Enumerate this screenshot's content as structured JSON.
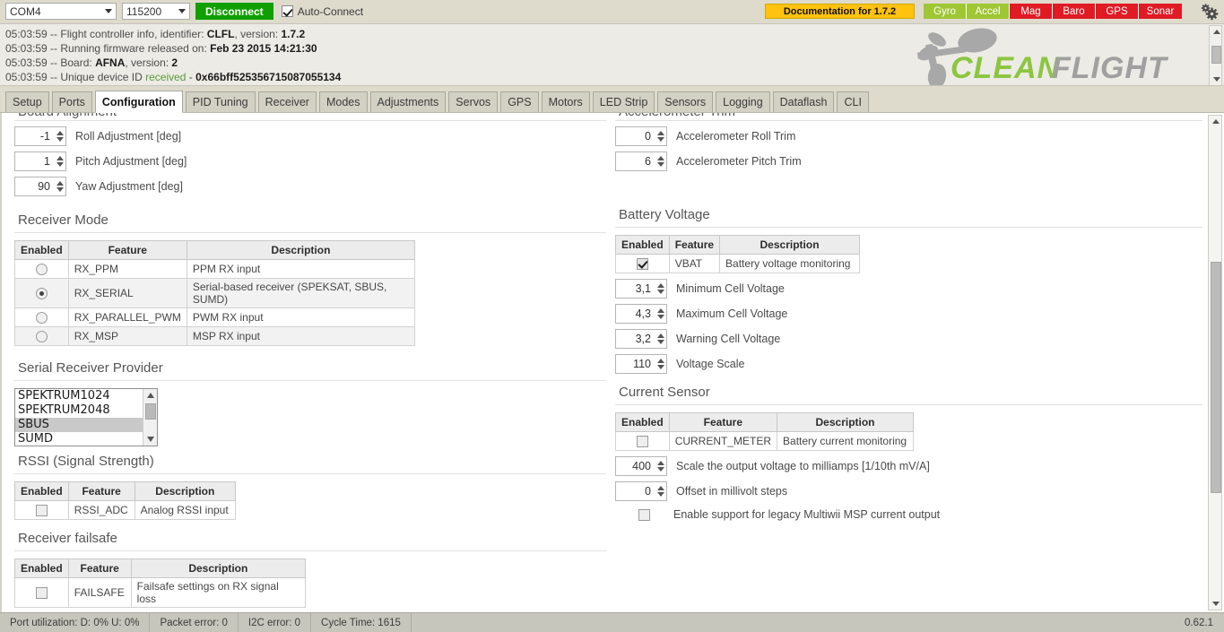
{
  "topbar": {
    "port": "COM4",
    "baud": "115200",
    "connect_label": "Disconnect",
    "autoconnect_label": "Auto-Connect",
    "autoconnect_checked": true,
    "documentation_label": "Documentation for 1.7.2",
    "doc_color": "#ffc20e",
    "sensors": [
      {
        "label": "Gyro",
        "color": "#9fc633",
        "active": true
      },
      {
        "label": "Accel",
        "color": "#9fc633",
        "active": true
      },
      {
        "label": "Mag",
        "color": "#e01b24",
        "active": false
      },
      {
        "label": "Baro",
        "color": "#e01b24",
        "active": false
      },
      {
        "label": "GPS",
        "color": "#e01b24",
        "active": false
      },
      {
        "label": "Sonar",
        "color": "#e01b24",
        "active": false
      }
    ],
    "gear_icon": "gear-icon"
  },
  "header_log": {
    "lines": [
      {
        "time": "05:03:59",
        "sep": " -- ",
        "text": "Flight controller info, identifier: ",
        "bold1": "CLFL",
        "mid": ", version: ",
        "bold2": "1.7.2"
      },
      {
        "time": "05:03:59",
        "sep": " -- ",
        "text": "Running firmware released on: ",
        "bold1": "Feb 23 2015 14:21:30",
        "mid": "",
        "bold2": ""
      },
      {
        "time": "05:03:59",
        "sep": " -- ",
        "text": "Board: ",
        "bold1": "AFNA",
        "mid": ", version: ",
        "bold2": "2"
      },
      {
        "time": "05:03:59",
        "sep": " -- ",
        "text": "Unique device ID received - ",
        "bold1": "0x66bff525356715087055134",
        "mid": "",
        "bold2": ""
      }
    ],
    "logo_text_1": "CLEAN",
    "logo_text_2": "FLIGHT",
    "logo_color_1": "#8cc63f",
    "logo_color_2": "#a0a0a0"
  },
  "tabs": [
    {
      "label": "Setup",
      "active": false
    },
    {
      "label": "Ports",
      "active": false
    },
    {
      "label": "Configuration",
      "active": true
    },
    {
      "label": "PID Tuning",
      "active": false
    },
    {
      "label": "Receiver",
      "active": false
    },
    {
      "label": "Modes",
      "active": false
    },
    {
      "label": "Adjustments",
      "active": false
    },
    {
      "label": "Servos",
      "active": false
    },
    {
      "label": "GPS",
      "active": false
    },
    {
      "label": "Motors",
      "active": false
    },
    {
      "label": "LED Strip",
      "active": false
    },
    {
      "label": "Sensors",
      "active": false
    },
    {
      "label": "Logging",
      "active": false
    },
    {
      "label": "Dataflash",
      "active": false
    },
    {
      "label": "CLI",
      "active": false
    }
  ],
  "board_alignment": {
    "title": "Board Alignment",
    "rows": [
      {
        "value": "-1",
        "label": "Roll Adjustment [deg]"
      },
      {
        "value": "1",
        "label": "Pitch Adjustment [deg]"
      },
      {
        "value": "90",
        "label": "Yaw Adjustment [deg]"
      }
    ]
  },
  "receiver_mode": {
    "title": "Receiver Mode",
    "headers": [
      "Enabled",
      "Feature",
      "Description"
    ],
    "rows": [
      {
        "feature": "RX_PPM",
        "description": "PPM RX input",
        "selected": false
      },
      {
        "feature": "RX_SERIAL",
        "description": "Serial-based receiver (SPEKSAT, SBUS, SUMD)",
        "selected": true
      },
      {
        "feature": "RX_PARALLEL_PWM",
        "description": "PWM RX input",
        "selected": false
      },
      {
        "feature": "RX_MSP",
        "description": "MSP RX input",
        "selected": false
      }
    ]
  },
  "serial_receiver_provider": {
    "title": "Serial Receiver Provider",
    "options": [
      "SPEKTRUM1024",
      "SPEKTRUM2048",
      "SBUS",
      "SUMD"
    ],
    "selected": "SBUS"
  },
  "rssi": {
    "title": "RSSI (Signal Strength)",
    "headers": [
      "Enabled",
      "Feature",
      "Description"
    ],
    "rows": [
      {
        "feature": "RSSI_ADC",
        "description": "Analog RSSI input",
        "checked": false
      }
    ]
  },
  "receiver_failsafe": {
    "title": "Receiver failsafe",
    "headers": [
      "Enabled",
      "Feature",
      "Description"
    ],
    "rows": [
      {
        "feature": "FAILSAFE",
        "description": "Failsafe settings on RX signal loss",
        "checked": false
      }
    ]
  },
  "accelerometer_trim": {
    "title": "Accelerometer Trim",
    "rows": [
      {
        "value": "0",
        "label": "Accelerometer Roll Trim"
      },
      {
        "value": "6",
        "label": "Accelerometer Pitch Trim"
      }
    ]
  },
  "battery_voltage": {
    "title": "Battery Voltage",
    "headers": [
      "Enabled",
      "Feature",
      "Description"
    ],
    "rows": [
      {
        "feature": "VBAT",
        "description": "Battery voltage monitoring",
        "checked": true
      }
    ],
    "spinners": [
      {
        "value": "3,1",
        "label": "Minimum Cell Voltage"
      },
      {
        "value": "4,3",
        "label": "Maximum Cell Voltage"
      },
      {
        "value": "3,2",
        "label": "Warning Cell Voltage"
      },
      {
        "value": "110",
        "label": "Voltage Scale"
      }
    ]
  },
  "current_sensor": {
    "title": "Current Sensor",
    "headers": [
      "Enabled",
      "Feature",
      "Description"
    ],
    "rows": [
      {
        "feature": "CURRENT_METER",
        "description": "Battery current monitoring",
        "checked": false
      }
    ],
    "spinners": [
      {
        "value": "400",
        "label": "Scale the output voltage to milliamps [1/10th mV/A]"
      },
      {
        "value": "0",
        "label": "Offset in millivolt steps"
      }
    ],
    "legacy_label": "Enable support for legacy Multiwii MSP current output",
    "legacy_checked": false
  },
  "statusbar": {
    "cells": [
      "Port utilization: D: 0% U: 0%",
      "Packet error: 0",
      "I2C error: 0",
      "Cycle Time: 1615"
    ],
    "version": "0.62.1"
  }
}
